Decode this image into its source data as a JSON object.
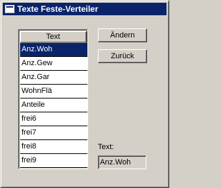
{
  "window": {
    "title": "Texte Feste-Verteiler"
  },
  "list": {
    "column_header": "Text",
    "items": [
      "Anz.Woh",
      "Anz.Gew",
      "Anz.Gar",
      "WohnFlä",
      "Anteile",
      "frei6",
      "frei7",
      "frei8",
      "frei9"
    ],
    "selected_index": 0
  },
  "buttons": {
    "change_label": "Ändern",
    "back_label": "Zurück"
  },
  "text_field": {
    "label": "Text:",
    "value": "Anz.Woh"
  },
  "colors": {
    "titlebar": "#0a246a",
    "selection": "#0a246a",
    "face": "#d4d0c8"
  }
}
